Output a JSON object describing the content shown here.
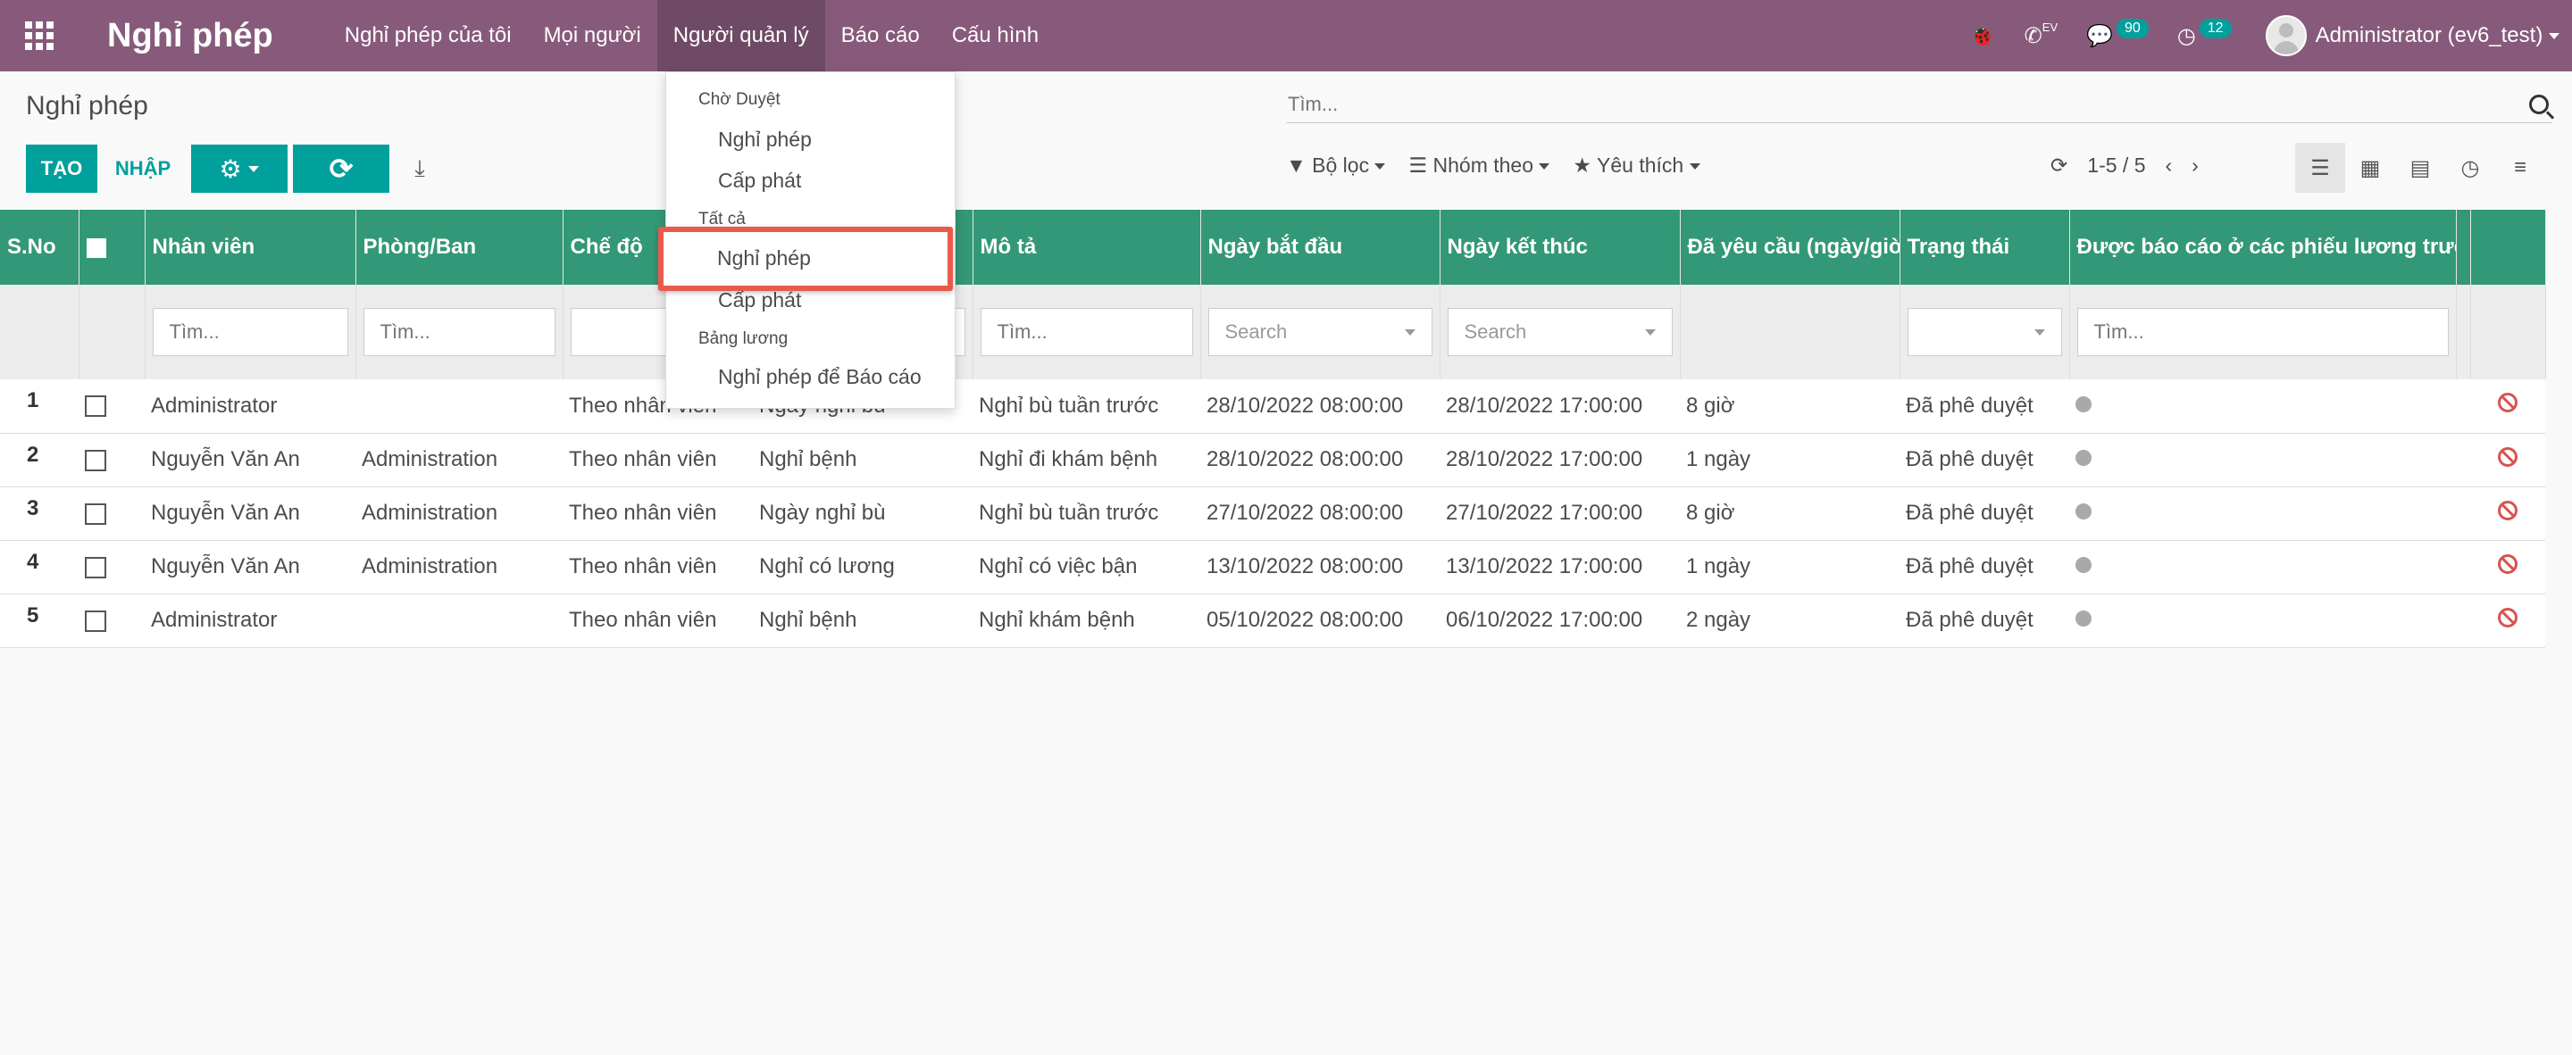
{
  "navbar": {
    "brand": "Nghỉ phép",
    "menu": [
      "Nghỉ phép của tôi",
      "Mọi người",
      "Người quản lý",
      "Báo cáo",
      "Cấu hình"
    ],
    "active_menu": "Người quản lý",
    "phone_sup": "EV",
    "messages_count": "90",
    "activities_count": "12",
    "user": "Administrator (ev6_test)"
  },
  "control": {
    "breadcrumb": "Nghỉ phép",
    "search_placeholder": "Tìm...",
    "create": "TẠO",
    "import": "NHẬP",
    "filter": "Bộ lọc",
    "group_by": "Nhóm theo",
    "favorites": "Yêu thích",
    "pager": "1-5 / 5"
  },
  "dropdown": {
    "section1": "Chờ Duyệt",
    "s1_item1": "Nghỉ phép",
    "s1_item2": "Cấp phát",
    "section2": "Tất cả",
    "s2_item1": "Nghỉ phép",
    "s2_item2": "Cấp phát",
    "section3": "Bảng lương",
    "s3_item1": "Nghỉ phép để Báo cáo"
  },
  "table": {
    "headers": {
      "sno": "S.No",
      "employee": "Nhân viên",
      "department": "Phòng/Ban",
      "mode": "Chế độ",
      "type": "",
      "description": "Mô tả",
      "start": "Ngày bắt đầu",
      "end": "Ngày kết thúc",
      "requested": "Đã yêu cầu (ngày/giờ)",
      "state": "Trạng thái",
      "reported": "Được báo cáo ở các phiếu lương trước"
    },
    "filter_placeholder": "Tìm...",
    "select_placeholder": "Search",
    "rows": [
      {
        "sno": "1",
        "employee": "Administrator",
        "department": "",
        "mode": "Theo nhân viên",
        "type": "Ngày nghỉ bù",
        "description": "Nghỉ bù tuần trước",
        "start": "28/10/2022 08:00:00",
        "end": "28/10/2022 17:00:00",
        "requested": "8 giờ",
        "state": "Đã phê duyệt"
      },
      {
        "sno": "2",
        "employee": "Nguyễn Văn An",
        "department": "Administration",
        "mode": "Theo nhân viên",
        "type": "Nghỉ bệnh",
        "description": "Nghỉ đi khám bệnh",
        "start": "28/10/2022 08:00:00",
        "end": "28/10/2022 17:00:00",
        "requested": "1 ngày",
        "state": "Đã phê duyệt"
      },
      {
        "sno": "3",
        "employee": "Nguyễn Văn An",
        "department": "Administration",
        "mode": "Theo nhân viên",
        "type": "Ngày nghỉ bù",
        "description": "Nghỉ bù tuần trước",
        "start": "27/10/2022 08:00:00",
        "end": "27/10/2022 17:00:00",
        "requested": "8 giờ",
        "state": "Đã phê duyệt"
      },
      {
        "sno": "4",
        "employee": "Nguyễn Văn An",
        "department": "Administration",
        "mode": "Theo nhân viên",
        "type": "Nghỉ có lương",
        "description": "Nghỉ có việc bận",
        "start": "13/10/2022 08:00:00",
        "end": "13/10/2022 17:00:00",
        "requested": "1 ngày",
        "state": "Đã phê duyệt"
      },
      {
        "sno": "5",
        "employee": "Administrator",
        "department": "",
        "mode": "Theo nhân viên",
        "type": "Nghỉ bệnh",
        "description": "Nghỉ khám bệnh",
        "start": "05/10/2022 08:00:00",
        "end": "06/10/2022 17:00:00",
        "requested": "2 ngày",
        "state": "Đã phê duyệt"
      }
    ]
  },
  "colors": {
    "navbar": "#875a7b",
    "primary": "#00a09d",
    "table_header": "#339877",
    "highlight": "#e85b4c"
  }
}
